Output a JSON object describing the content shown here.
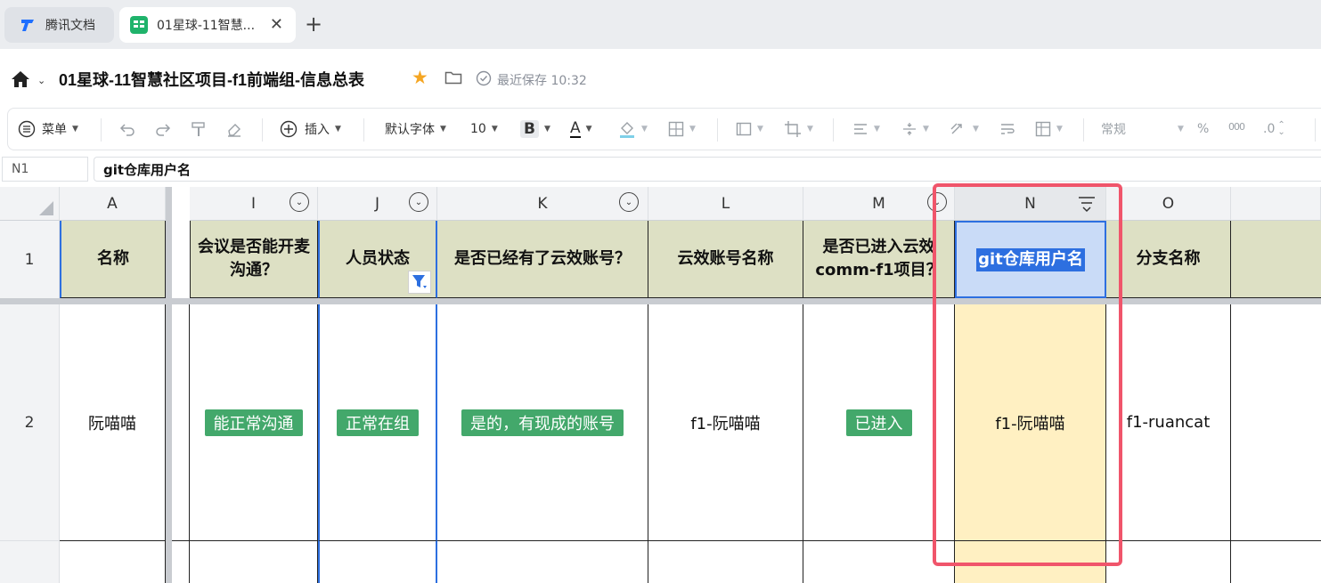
{
  "browser": {
    "tabs": [
      {
        "label": "腾讯文档",
        "icon": "tencent-docs-icon"
      },
      {
        "label": "01星球-11智慧...",
        "icon": "sheet-icon",
        "active": true
      }
    ],
    "new_tab_label": "+"
  },
  "doc": {
    "title": "01星球-11智慧社区项目-f1前端组-信息总表",
    "save_status": "最近保存 10:32"
  },
  "toolbar": {
    "menu": "菜单",
    "insert": "插入",
    "font": "默认字体",
    "font_size": "10",
    "bold": "B",
    "font_color": "A",
    "number_format": "常规",
    "percent": "%",
    "thousands": "000",
    "decimal": ".0"
  },
  "formula": {
    "cell_ref": "N1",
    "value": "git仓库用户名"
  },
  "grid": {
    "columns": [
      "A",
      "I",
      "J",
      "K",
      "L",
      "M",
      "N",
      "O"
    ],
    "rows": [
      "1",
      "2"
    ],
    "headers": {
      "A": "名称",
      "I": "会议是否能开麦沟通？",
      "J": "人员状态",
      "K": "是否已经有了云效账号？",
      "L": "云效账号名称",
      "M": "是否已进入云效comm-f1项目？",
      "N": "git仓库用户名",
      "O": "分支名称"
    },
    "row2": {
      "A": "阮喵喵",
      "I": "能正常沟通",
      "J": "正常在组",
      "K": "是的，有现成的账号",
      "L": "f1-阮喵喵",
      "M": "已进入",
      "N": "f1-阮喵喵",
      "O": "f1-ruancat"
    }
  },
  "colors": {
    "header_fill": "#dde0c4",
    "tag_green": "#43a86b",
    "selection_blue": "#2d6fe0",
    "highlight_yellow": "#fff0c2",
    "annotation_red": "#f0556b"
  }
}
